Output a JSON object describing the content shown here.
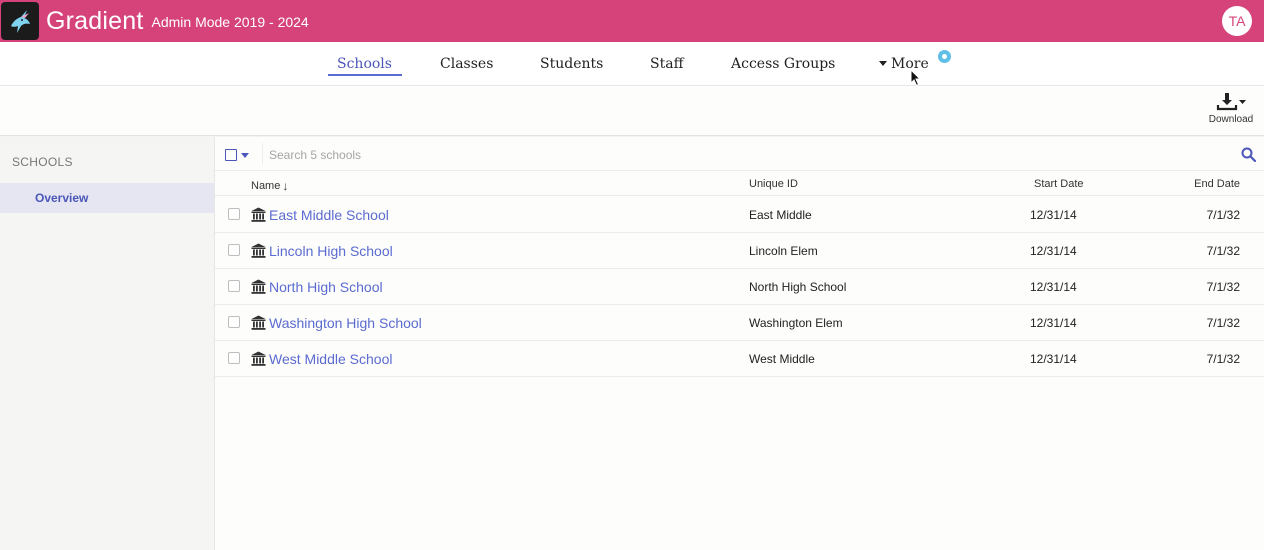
{
  "header": {
    "app_name": "Gradient",
    "mode": "Admin Mode 2019 - 2024",
    "avatar_initials": "TA",
    "brand_color": "#d6437a"
  },
  "nav": {
    "tabs": [
      {
        "label": "Schools",
        "active": true
      },
      {
        "label": "Classes",
        "active": false
      },
      {
        "label": "Students",
        "active": false
      },
      {
        "label": "Staff",
        "active": false
      },
      {
        "label": "Access Groups",
        "active": false
      }
    ],
    "more_label": "More",
    "accent_color": "#5b6bd1"
  },
  "toolbar": {
    "download_label": "Download"
  },
  "sidebar": {
    "heading": "SCHOOLS",
    "items": [
      {
        "label": "Overview",
        "active": true
      }
    ]
  },
  "search": {
    "placeholder": "Search 5 schools",
    "value": ""
  },
  "table": {
    "columns": [
      "Name",
      "Unique ID",
      "Start Date",
      "End Date"
    ],
    "sort_column": "Name",
    "rows": [
      {
        "name": "East Middle School",
        "unique_id": "East Middle",
        "start_date": "12/31/14",
        "end_date": "7/1/32"
      },
      {
        "name": "Lincoln High School",
        "unique_id": "Lincoln Elem",
        "start_date": "12/31/14",
        "end_date": "7/1/32"
      },
      {
        "name": "North High School",
        "unique_id": "North High School",
        "start_date": "12/31/14",
        "end_date": "7/1/32"
      },
      {
        "name": "Washington High School",
        "unique_id": "Washington Elem",
        "start_date": "12/31/14",
        "end_date": "7/1/32"
      },
      {
        "name": "West Middle School",
        "unique_id": "West Middle",
        "start_date": "12/31/14",
        "end_date": "7/1/32"
      }
    ]
  }
}
